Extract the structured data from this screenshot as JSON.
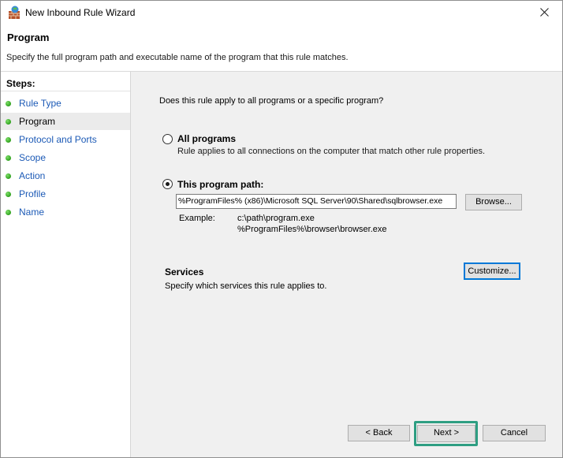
{
  "window": {
    "title": "New Inbound Rule Wizard",
    "close_glyph": "✕"
  },
  "header": {
    "title": "Program",
    "description": "Specify the full program path and executable name of the program that this rule matches."
  },
  "sidebar": {
    "heading": "Steps:",
    "items": [
      {
        "label": "Rule Type",
        "active": false
      },
      {
        "label": "Program",
        "active": true
      },
      {
        "label": "Protocol and Ports",
        "active": false
      },
      {
        "label": "Scope",
        "active": false
      },
      {
        "label": "Action",
        "active": false
      },
      {
        "label": "Profile",
        "active": false
      },
      {
        "label": "Name",
        "active": false
      }
    ]
  },
  "main": {
    "question": "Does this rule apply to all programs or a specific program?",
    "all_programs": {
      "label": "All programs",
      "description": "Rule applies to all connections on the computer that match other rule properties.",
      "selected": false
    },
    "program_path": {
      "label": "This program path:",
      "selected": true,
      "value": "%ProgramFiles% (x86)\\Microsoft SQL Server\\90\\Shared\\sqlbrowser.exe",
      "browse_label": "Browse..."
    },
    "example": {
      "label": "Example:",
      "line1": "c:\\path\\program.exe",
      "line2": "%ProgramFiles%\\browser\\browser.exe"
    },
    "services": {
      "title": "Services",
      "description": "Specify which services this rule applies to.",
      "customize_label": "Customize..."
    }
  },
  "footer": {
    "back_label": "< Back",
    "next_label": "Next >",
    "cancel_label": "Cancel"
  },
  "colors": {
    "link": "#1c5ab6",
    "focus_blue": "#0078d7",
    "highlight_teal": "#2e9e82",
    "step_dot_green": "#2ea11c"
  }
}
